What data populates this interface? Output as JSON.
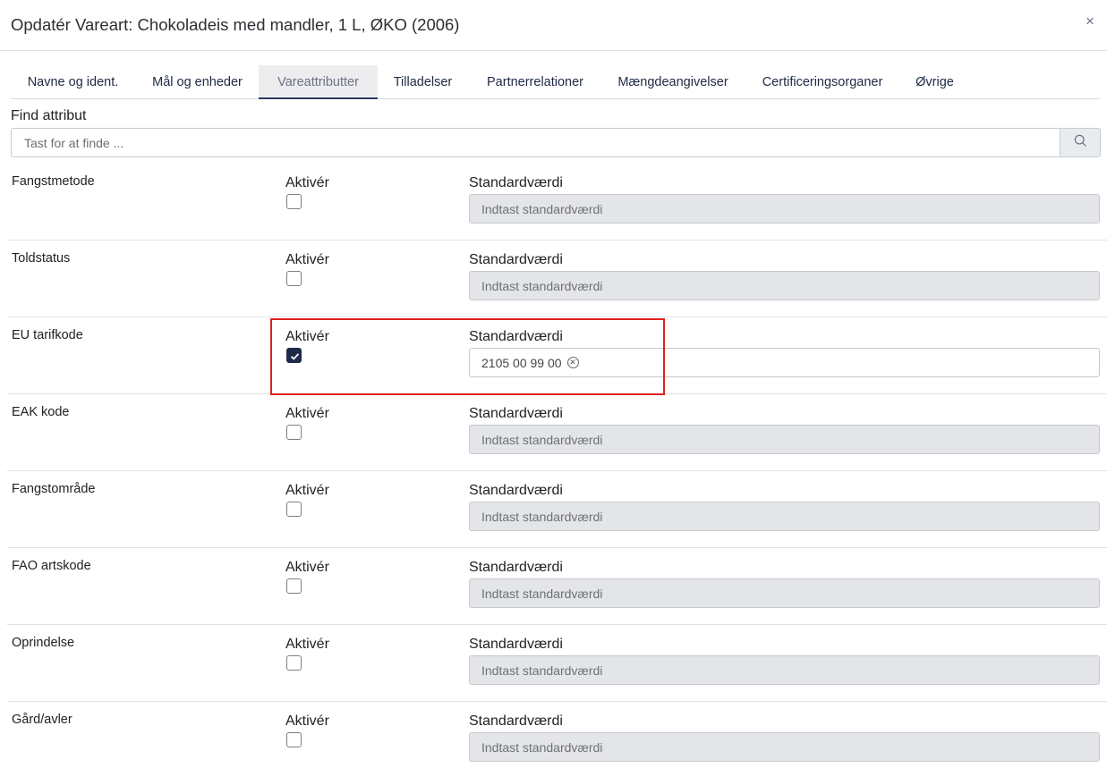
{
  "modal": {
    "title": "Opdatér Vareart: Chokoladeis med mandler, 1 L, ØKO (2006)",
    "close_label": "×"
  },
  "tabs": [
    {
      "label": "Navne og ident.",
      "active": false
    },
    {
      "label": "Mål og enheder",
      "active": false
    },
    {
      "label": "Vareattributter",
      "active": true
    },
    {
      "label": "Tilladelser",
      "active": false
    },
    {
      "label": "Partnerrelationer",
      "active": false
    },
    {
      "label": "Mængdeangivelser",
      "active": false
    },
    {
      "label": "Certificeringsorganer",
      "active": false
    },
    {
      "label": "Øvrige",
      "active": false
    }
  ],
  "search": {
    "label": "Find attribut",
    "placeholder": "Tast for at finde ...",
    "button_icon": "search-icon"
  },
  "attributes": [
    {
      "name": "Fangstmetode",
      "aktiver_label": "Aktivér",
      "checked": false,
      "std_label": "Standardværdi",
      "placeholder": "Indtast standardværdi",
      "value": ""
    },
    {
      "name": "Toldstatus",
      "aktiver_label": "Aktivér",
      "checked": false,
      "std_label": "Standardværdi",
      "placeholder": "Indtast standardværdi",
      "value": ""
    },
    {
      "name": "EU tarifkode",
      "aktiver_label": "Aktivér",
      "checked": true,
      "std_label": "Standardværdi",
      "placeholder": "",
      "value": "2105 00 99 00"
    },
    {
      "name": "EAK kode",
      "aktiver_label": "Aktivér",
      "checked": false,
      "std_label": "Standardværdi",
      "placeholder": "Indtast standardværdi",
      "value": ""
    },
    {
      "name": "Fangstområde",
      "aktiver_label": "Aktivér",
      "checked": false,
      "std_label": "Standardværdi",
      "placeholder": "Indtast standardværdi",
      "value": ""
    },
    {
      "name": "FAO artskode",
      "aktiver_label": "Aktivér",
      "checked": false,
      "std_label": "Standardværdi",
      "placeholder": "Indtast standardværdi",
      "value": ""
    },
    {
      "name": "Oprindelse",
      "aktiver_label": "Aktivér",
      "checked": false,
      "std_label": "Standardværdi",
      "placeholder": "Indtast standardværdi",
      "value": ""
    },
    {
      "name": "Gård/avler",
      "aktiver_label": "Aktivér",
      "checked": false,
      "std_label": "Standardværdi",
      "placeholder": "Indtast standardværdi",
      "value": ""
    }
  ],
  "colors": {
    "highlight": "#e02020",
    "checkbox_checked": "#1e2a4a",
    "tab_active_underline": "#2a3a5c"
  }
}
